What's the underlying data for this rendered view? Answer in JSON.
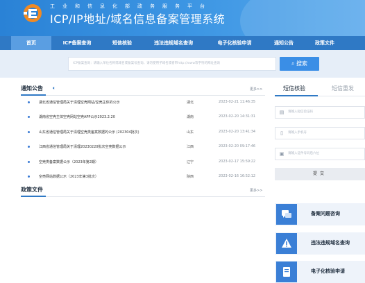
{
  "header": {
    "subtitle": "工业和信息化部政务服务平台",
    "title": "ICP/IP地址/域名信息备案管理系统"
  },
  "nav": {
    "items": [
      {
        "label": "首页",
        "active": true
      },
      {
        "label": "ICP备案查询",
        "active": false
      },
      {
        "label": "短信核验",
        "active": false
      },
      {
        "label": "违法违规域名查询",
        "active": false
      },
      {
        "label": "电子化核验申请",
        "active": false
      },
      {
        "label": "通知公告",
        "active": false
      },
      {
        "label": "政策文件",
        "active": false
      }
    ]
  },
  "search": {
    "placeholder": "ICP备案查询：请输入单位名称或域名或备案号查询，请勿使用子域名或者带http://www等字符的网址查询",
    "button_label": "搜索"
  },
  "notices": {
    "title": "通知公告",
    "more_label": "更多>>",
    "items": [
      {
        "title": "湖北省通信管理局关于清理空壳网站/空壳主体的公示",
        "region": "湖北",
        "date": "2023-02-21 11:46:35"
      },
      {
        "title": "湖南省空壳主体空壳网站空壳APP公示2023.2.20",
        "region": "湖南",
        "date": "2023-02-20 14:31:31"
      },
      {
        "title": "山东省通信管理局关于清理空壳类备案数据的公示 (202304批次)",
        "region": "山东",
        "date": "2023-02-20 13:41:34"
      },
      {
        "title": "江西省通信管理局关于清理20230220批次空壳数据公示",
        "region": "江西",
        "date": "2023-02-20 09:17:46"
      },
      {
        "title": "空壳类备案数据公示（2023年第2期）",
        "region": "辽宁",
        "date": "2023-02-17 15:59:22"
      },
      {
        "title": "空壳网站数据公示（2023年第3批次）",
        "region": "陕西",
        "date": "2023-02-16 16:52:12"
      }
    ]
  },
  "policy": {
    "title": "政策文件",
    "more_label": "更多>>"
  },
  "sms": {
    "tab_active": "短信核验",
    "tab_inactive": "短信重发",
    "fields": [
      {
        "placeholder": "请输入短信验证码",
        "icon": "document-icon"
      },
      {
        "placeholder": "请输入手机号",
        "icon": "phone-icon"
      },
      {
        "placeholder": "请输入证件号码后六位",
        "icon": "id-card-icon"
      }
    ],
    "submit_label": "提交"
  },
  "services": [
    {
      "label": "备案问题咨询",
      "icon": "chat-icon"
    },
    {
      "label": "违法违规域名查询",
      "icon": "warning-icon"
    },
    {
      "label": "电子化核验申请",
      "icon": "document-icon"
    }
  ],
  "colors": {
    "header_blue": "#3e97e4",
    "nav_blue": "#2f79c5",
    "nav_active": "#5a9ee2",
    "accent": "#3a8ee6",
    "logo_orange": "#f08a24"
  }
}
